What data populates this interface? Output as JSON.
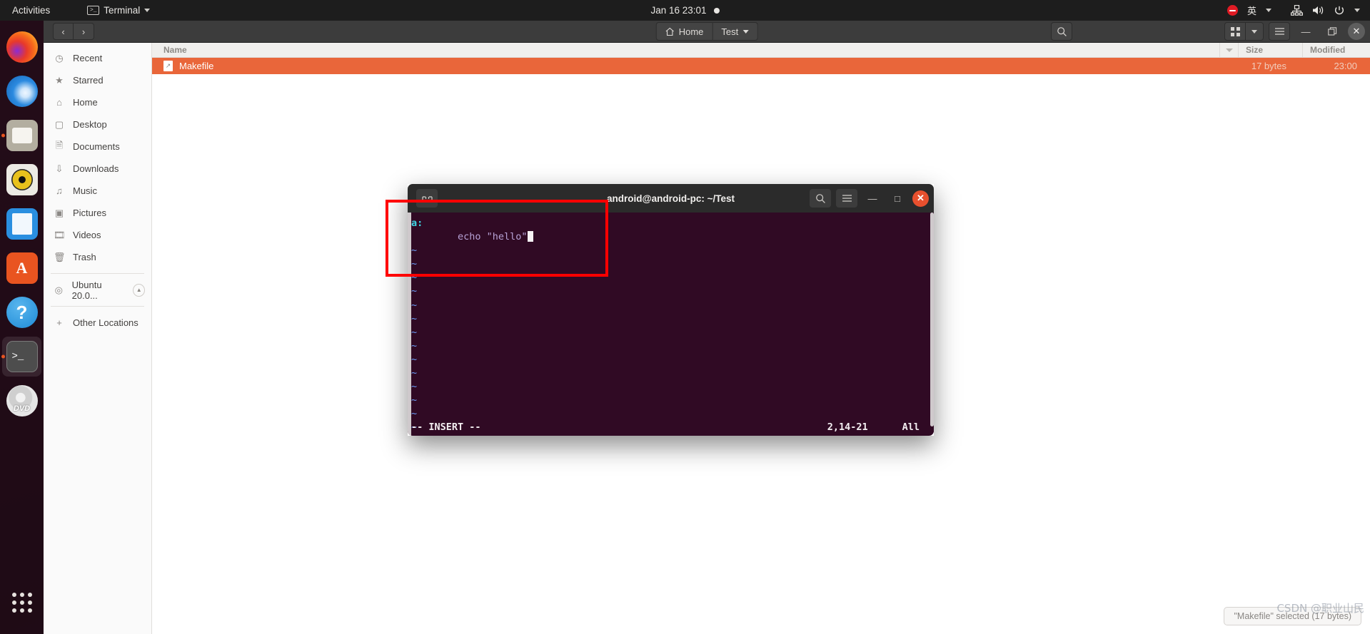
{
  "topbar": {
    "activities": "Activities",
    "app_menu": "Terminal",
    "clock": "Jan 16  23:01",
    "icons": [
      "terminal-icon",
      "chevron-down-icon",
      "notification-dot",
      "do-not-disturb-icon",
      "network-icon",
      "volume-icon",
      "power-icon"
    ],
    "ime": "英"
  },
  "dock": {
    "items": [
      {
        "name": "firefox",
        "label": "Firefox",
        "running": false
      },
      {
        "name": "thunderbird",
        "label": "Thunderbird",
        "running": false
      },
      {
        "name": "files",
        "label": "Files",
        "running": true
      },
      {
        "name": "rhythmbox",
        "label": "Rhythmbox",
        "running": false
      },
      {
        "name": "writer",
        "label": "LibreOffice Writer",
        "running": false
      },
      {
        "name": "software",
        "label": "Ubuntu Software",
        "running": false,
        "glyph": "A"
      },
      {
        "name": "help",
        "label": "Help",
        "running": false,
        "glyph": "?"
      },
      {
        "name": "terminal",
        "label": "Terminal",
        "running": true,
        "glyph": ">_"
      },
      {
        "name": "dvd",
        "label": "DVD",
        "running": false,
        "glyph": "DVD"
      }
    ],
    "show_apps": "Show Applications"
  },
  "files": {
    "nav_back": "‹",
    "nav_forward": "›",
    "breadcrumb": [
      {
        "label": "Home",
        "icon": "home-icon"
      },
      {
        "label": "Test",
        "icon": "chevron-down-icon"
      }
    ],
    "search_icon": "search-icon",
    "view_icon": "grid-view-icon",
    "view_caret": "chevron-down-icon",
    "menu_icon": "hamburger-menu-icon",
    "minimize": "—",
    "maximize": "❐",
    "close": "✕",
    "sidebar": [
      {
        "label": "Recent",
        "icon": "clock-icon"
      },
      {
        "label": "Starred",
        "icon": "star-icon"
      },
      {
        "label": "Home",
        "icon": "home-icon"
      },
      {
        "label": "Desktop",
        "icon": "desktop-icon"
      },
      {
        "label": "Documents",
        "icon": "document-icon"
      },
      {
        "label": "Downloads",
        "icon": "download-icon"
      },
      {
        "label": "Music",
        "icon": "music-note-icon"
      },
      {
        "label": "Pictures",
        "icon": "picture-icon"
      },
      {
        "label": "Videos",
        "icon": "film-icon"
      },
      {
        "label": "Trash",
        "icon": "trash-icon"
      }
    ],
    "volume": {
      "label": "Ubuntu 20.0...",
      "icon": "disc-icon",
      "eject": "eject-icon"
    },
    "other_locations": {
      "label": "Other Locations",
      "icon": "plus-icon"
    },
    "columns": {
      "name": "Name",
      "size": "Size",
      "modified": "Modified"
    },
    "rows": [
      {
        "name": "Makefile",
        "size": "17 bytes",
        "modified": "23:00",
        "icon": "text-file-icon",
        "selected": true
      }
    ],
    "status_popup": "\"Makefile\" selected (17 bytes)"
  },
  "terminal": {
    "title": "android@android-pc: ~/Test",
    "search_icon": "search-icon",
    "menu_icon": "hamburger-menu-icon",
    "minimize": "—",
    "maximize": "□",
    "close": "✕",
    "tab_icon": "terminal-tab-icon",
    "vim": {
      "lines": [
        {
          "type": "target",
          "text": "a:"
        },
        {
          "type": "cmd",
          "text": "        echo \"hello\"",
          "cursor": true
        },
        {
          "type": "tilde",
          "text": "~"
        },
        {
          "type": "tilde",
          "text": "~"
        },
        {
          "type": "tilde",
          "text": "~"
        },
        {
          "type": "tilde",
          "text": "~"
        },
        {
          "type": "tilde",
          "text": "~"
        },
        {
          "type": "tilde",
          "text": "~"
        },
        {
          "type": "tilde",
          "text": "~"
        },
        {
          "type": "tilde",
          "text": "~"
        },
        {
          "type": "tilde",
          "text": "~"
        },
        {
          "type": "tilde",
          "text": "~"
        },
        {
          "type": "tilde",
          "text": "~"
        },
        {
          "type": "tilde",
          "text": "~"
        },
        {
          "type": "tilde",
          "text": "~"
        },
        {
          "type": "tilde",
          "text": "~"
        },
        {
          "type": "tilde",
          "text": "~"
        }
      ],
      "mode": "-- INSERT --",
      "position": "2,14-21",
      "scroll": "All"
    }
  },
  "watermark": "CSDN @职业山民",
  "colors": {
    "accent_orange": "#e95420",
    "selection_orange": "#e9663a",
    "terminal_bg": "#300a24",
    "topbar_bg": "#1d1d1d",
    "annotation_red": "#ff0000"
  }
}
